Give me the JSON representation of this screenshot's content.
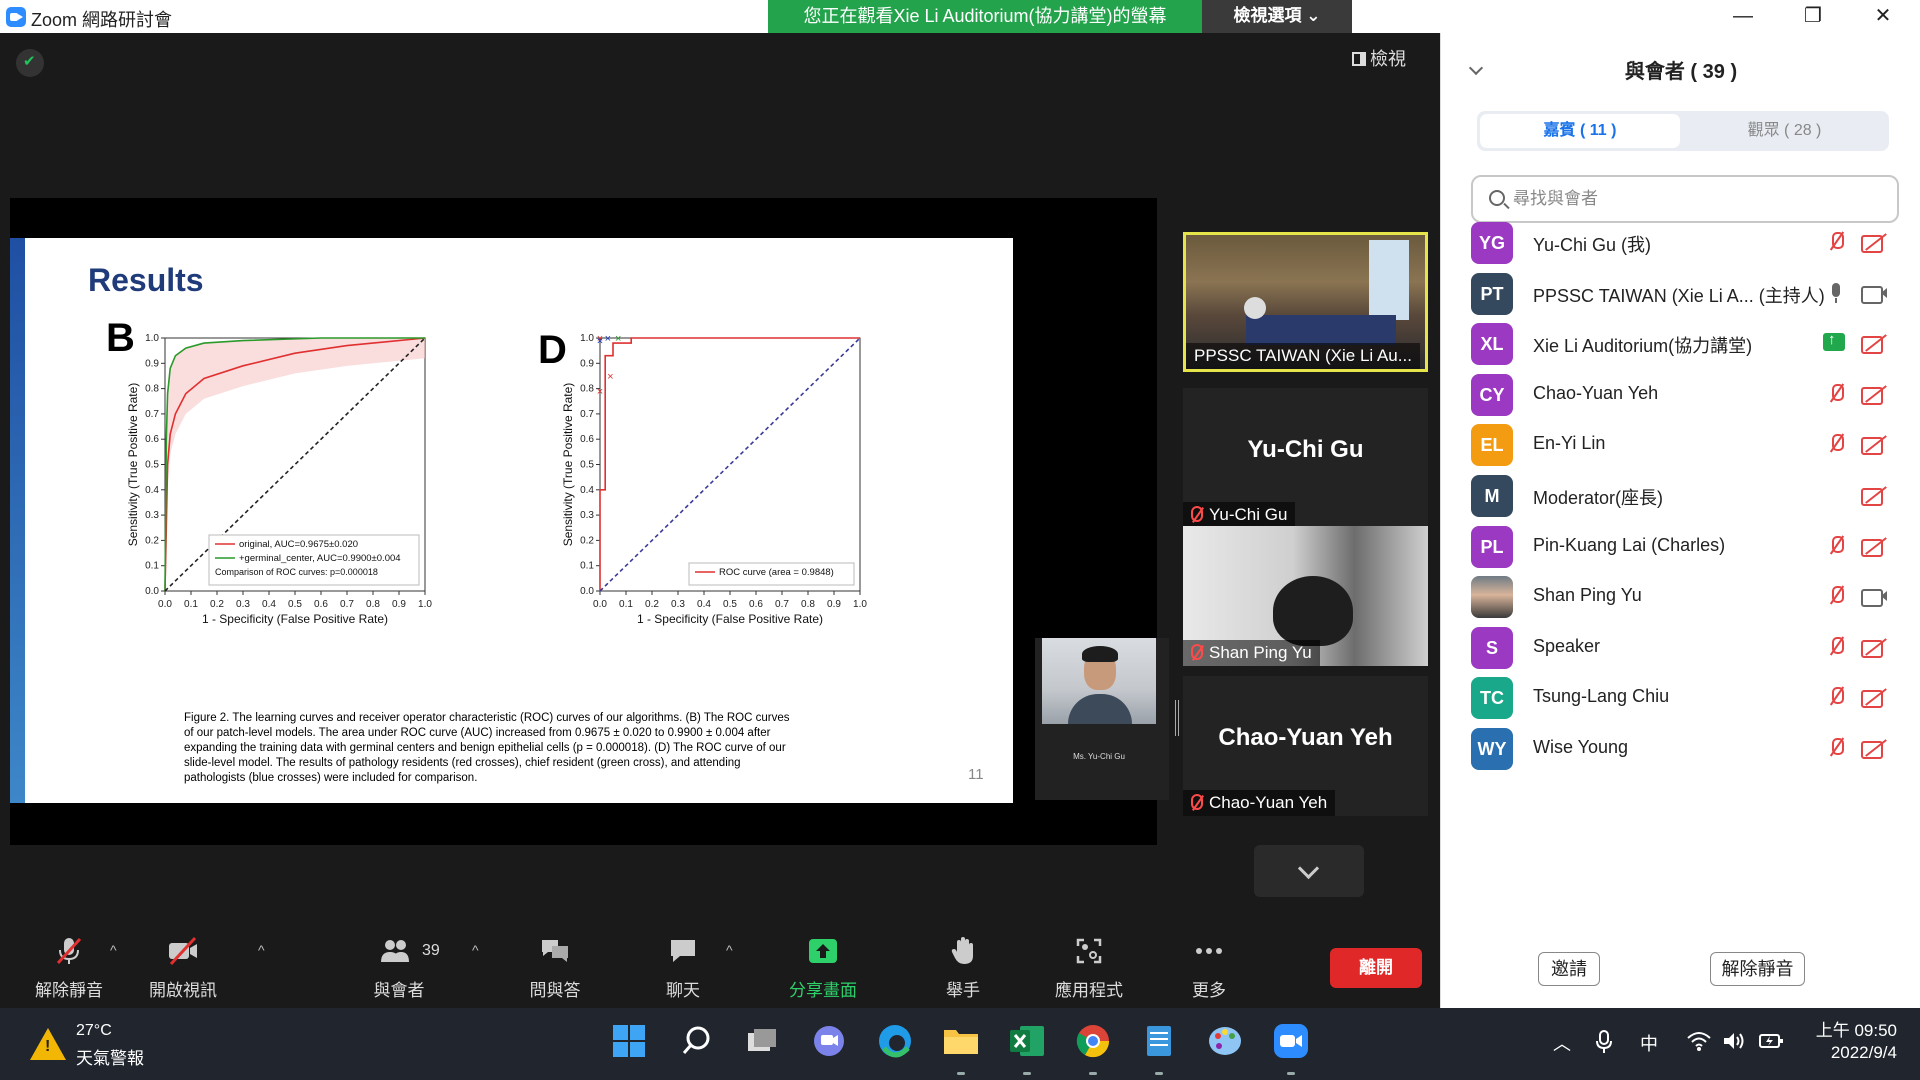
{
  "window": {
    "title": "Zoom 網路研討會",
    "share_banner": "您正在觀看Xie Li Auditorium(協力講堂)的螢幕",
    "view_options": "檢視選項 ⌄",
    "minimize": "—",
    "maximize": "❐",
    "close": "✕"
  },
  "stage": {
    "view_button": "檢視"
  },
  "slide": {
    "heading": "Results",
    "panel_b": "B",
    "panel_d": "D",
    "caption": "Figure 2. The learning curves and receiver operator characteristic (ROC) curves of our algorithms. (B) The ROC curves of our patch-level models. The area under ROC curve (AUC) increased from 0.9675 ± 0.020 to 0.9900 ± 0.004 after expanding the training data with germinal centers and benign epithelial cells (p = 0.000018). (D) The ROC curve of our slide-level model. The results of pathology residents (red crosses), chief resident (green cross), and attending pathologists (blue crosses) were included for comparison.",
    "page_number": "11"
  },
  "chart_data": [
    {
      "type": "line",
      "panel": "B",
      "xlabel": "1 - Specificity (False Positive Rate)",
      "ylabel": "Sensitivity (True Positive Rate)",
      "xlim": [
        0,
        1
      ],
      "ylim": [
        0,
        1
      ],
      "xticks": [
        "0.0",
        "0.1",
        "0.2",
        "0.3",
        "0.4",
        "0.5",
        "0.6",
        "0.7",
        "0.8",
        "0.9",
        "1.0"
      ],
      "yticks": [
        "0.0",
        "0.1",
        "0.2",
        "0.3",
        "0.4",
        "0.5",
        "0.6",
        "0.7",
        "0.8",
        "0.9",
        "1.0"
      ],
      "series": [
        {
          "name": "original, AUC=0.9675±0.020",
          "color": "#e03030",
          "x": [
            0,
            0.01,
            0.02,
            0.04,
            0.08,
            0.15,
            0.3,
            0.5,
            0.7,
            1.0
          ],
          "y": [
            0,
            0.5,
            0.62,
            0.7,
            0.78,
            0.84,
            0.89,
            0.94,
            0.97,
            1.0
          ]
        },
        {
          "name": "+germinal_center, AUC=0.9900±0.004",
          "color": "#2a9a2a",
          "x": [
            0,
            0.005,
            0.01,
            0.02,
            0.04,
            0.08,
            0.15,
            0.3,
            0.6,
            1.0
          ],
          "y": [
            0,
            0.6,
            0.78,
            0.88,
            0.93,
            0.96,
            0.98,
            0.99,
            1.0,
            1.0
          ]
        },
        {
          "name": "chance",
          "color": "#222222",
          "x": [
            0,
            1
          ],
          "y": [
            0,
            1
          ]
        }
      ],
      "legend_extra": "Comparison of ROC curves: p=0.000018",
      "legend_position": "bottom-right"
    },
    {
      "type": "line",
      "panel": "D",
      "xlabel": "1 - Specificity (False Positive Rate)",
      "ylabel": "Sensitivity (True Positive Rate)",
      "xlim": [
        0,
        1
      ],
      "ylim": [
        0,
        1
      ],
      "xticks": [
        "0.0",
        "0.1",
        "0.2",
        "0.3",
        "0.4",
        "0.5",
        "0.6",
        "0.7",
        "0.8",
        "0.9",
        "1.0"
      ],
      "yticks": [
        "0.0",
        "0.1",
        "0.2",
        "0.3",
        "0.4",
        "0.5",
        "0.6",
        "0.7",
        "0.8",
        "0.9",
        "1.0"
      ],
      "series": [
        {
          "name": "ROC curve (area = 0.9848)",
          "color": "#e03030",
          "x": [
            0,
            0,
            0.02,
            0.02,
            0.05,
            0.05,
            0.12,
            0.12,
            1.0
          ],
          "y": [
            0,
            0.4,
            0.4,
            0.93,
            0.93,
            0.98,
            0.98,
            1.0,
            1.0
          ]
        },
        {
          "name": "chance",
          "color": "#3a3a9a",
          "x": [
            0,
            1
          ],
          "y": [
            0,
            1
          ]
        }
      ],
      "markers": [
        {
          "color": "#e03030",
          "x": 0.0,
          "y": 0.79
        },
        {
          "color": "#e03030",
          "x": 0.04,
          "y": 0.85
        },
        {
          "color": "#e03030",
          "x": 0.0,
          "y": 1.0
        },
        {
          "color": "#2a9a2a",
          "x": 0.07,
          "y": 1.0
        },
        {
          "color": "#2040c0",
          "x": 0.0,
          "y": 0.99
        },
        {
          "color": "#2040c0",
          "x": 0.03,
          "y": 1.0
        }
      ],
      "legend_position": "bottom-right"
    }
  ],
  "presenter_thumb": {
    "name": "Ms. Yu-Chi Gu"
  },
  "strip": [
    {
      "label": "PPSSC TAIWAN (Xie Li Au...",
      "kind": "video-room",
      "active": true
    },
    {
      "label": "Yu-Chi Gu",
      "bigname": "Yu-Chi Gu",
      "kind": "name"
    },
    {
      "label": "Shan Ping Yu",
      "kind": "video-person"
    },
    {
      "label": "Chao-Yuan Yeh",
      "bigname": "Chao-Yuan Yeh",
      "kind": "name"
    }
  ],
  "toolbar": {
    "unmute": "解除靜音",
    "start_video": "開啟視訊",
    "participants": "與會者",
    "participants_count": "39",
    "qa": "問與答",
    "chat": "聊天",
    "share": "分享畫面",
    "raise_hand": "舉手",
    "apps": "應用程式",
    "more": "更多",
    "leave": "離開"
  },
  "panel": {
    "title": "與會者 ( 39 )",
    "tab_panelists": "嘉賓 ( 11 )",
    "tab_attendees": "觀眾 ( 28 )",
    "search_placeholder": "尋找與會者",
    "invite": "邀請",
    "unmute": "解除靜音",
    "participants": [
      {
        "initials": "YG",
        "name": "Yu-Chi Gu (我)",
        "color": "#9b39c2",
        "mic": "off",
        "cam": "off"
      },
      {
        "initials": "PT",
        "name": "PPSSC TAIWAN (Xie Li A... (主持人)",
        "color": "#34495e",
        "mic": "on",
        "cam": "on"
      },
      {
        "initials": "XL",
        "name": "Xie Li Auditorium(協力講堂)",
        "color": "#9b39c2",
        "mic": "off",
        "cam": "share"
      },
      {
        "initials": "CY",
        "name": "Chao-Yuan Yeh",
        "color": "#9b39c2",
        "mic": "off",
        "cam": "off"
      },
      {
        "initials": "EL",
        "name": "En-Yi Lin",
        "color": "#f39c12",
        "mic": "off",
        "cam": "off"
      },
      {
        "initials": "M",
        "name": "Moderator(座長)",
        "color": "#34495e",
        "mic": "none",
        "cam": "off"
      },
      {
        "initials": "PL",
        "name": "Pin-Kuang Lai (Charles)",
        "color": "#9b39c2",
        "mic": "off",
        "cam": "off"
      },
      {
        "initials": "",
        "name": "Shan Ping Yu",
        "color": "photo",
        "mic": "off",
        "cam": "on"
      },
      {
        "initials": "S",
        "name": "Speaker",
        "color": "#9b39c2",
        "mic": "off",
        "cam": "off"
      },
      {
        "initials": "TC",
        "name": "Tsung-Lang Chiu",
        "color": "#1aa88a",
        "mic": "off",
        "cam": "off"
      },
      {
        "initials": "WY",
        "name": "Wise Young",
        "color": "#2a6fb0",
        "mic": "off",
        "cam": "off"
      }
    ]
  },
  "taskbar": {
    "temperature": "27°C",
    "weather": "天氣警報",
    "ime": "中",
    "time": "上午 09:50",
    "date": "2022/9/4"
  }
}
